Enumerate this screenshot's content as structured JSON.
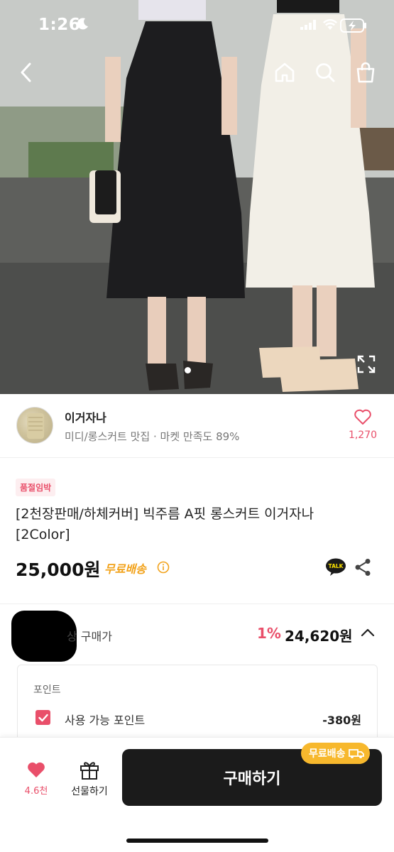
{
  "status_bar": {
    "time": "1:26"
  },
  "nav": {
    "back": "back",
    "home": "home",
    "search": "search",
    "cart": "cart"
  },
  "seller": {
    "name": "이거자나",
    "description": "미디/롱스커트 맛집 · 마켓 만족도 89%",
    "like_count": "1,270"
  },
  "product": {
    "badge": "품절임박",
    "title": "[2천장판매/하체커버] 빅주름 A핏 롱스커트 이거자나 [2Color]",
    "price": "25,000원",
    "shipping": "무료배송",
    "talk_label": "TALK"
  },
  "expected_price": {
    "label": "예상 구매가",
    "label_visible": "예상 구매가",
    "discount": "1%",
    "price": "24,620원"
  },
  "points": {
    "header": "포인트",
    "usable_label": "사용 가능 포인트",
    "usable_value": "-380원"
  },
  "bottom": {
    "wish_count": "4.6천",
    "gift_label": "선물하기",
    "buy_label": "구매하기",
    "buy_badge": "무료배송"
  },
  "colors": {
    "accent": "#e94f6a",
    "shipping": "#f2a21a",
    "buy_bg": "#1b1b1b",
    "badge_bg": "#f7b82d"
  }
}
